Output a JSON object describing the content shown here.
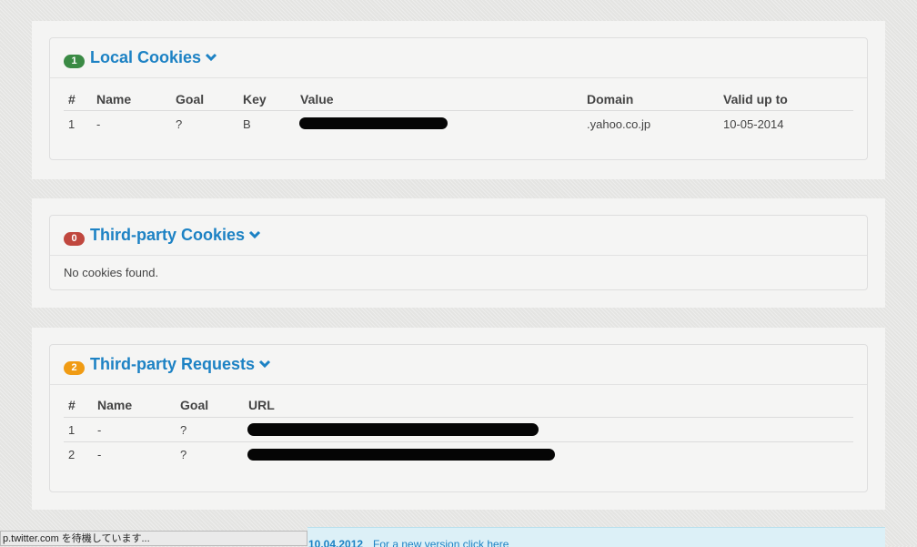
{
  "local_cookies": {
    "badge": "1",
    "badge_color": "#3a8a44",
    "title": "Local Cookies",
    "columns": [
      "#",
      "Name",
      "Goal",
      "Key",
      "Value",
      "Domain",
      "Valid up to"
    ],
    "rows": [
      {
        "num": "1",
        "name": "-",
        "goal": "?",
        "key": "B",
        "domain": ".yahoo.co.jp",
        "valid": "10-05-2014"
      }
    ]
  },
  "third_party_cookies": {
    "badge": "0",
    "badge_color": "#c0473e",
    "title": "Third-party Cookies",
    "empty_text": "No cookies found."
  },
  "third_party_requests": {
    "badge": "2",
    "badge_color": "#f09b13",
    "title": "Third-party Requests",
    "columns": [
      "#",
      "Name",
      "Goal",
      "URL"
    ],
    "rows": [
      {
        "num": "1",
        "name": "-",
        "goal": "?"
      },
      {
        "num": "2",
        "name": "-",
        "goal": "?"
      }
    ]
  },
  "status_bar": {
    "text": "p.twitter.com を待機しています..."
  },
  "footer": {
    "date": "10.04.2012",
    "text": "For a new version click here"
  },
  "icons": {
    "toggle": "chevron-down-icon"
  }
}
